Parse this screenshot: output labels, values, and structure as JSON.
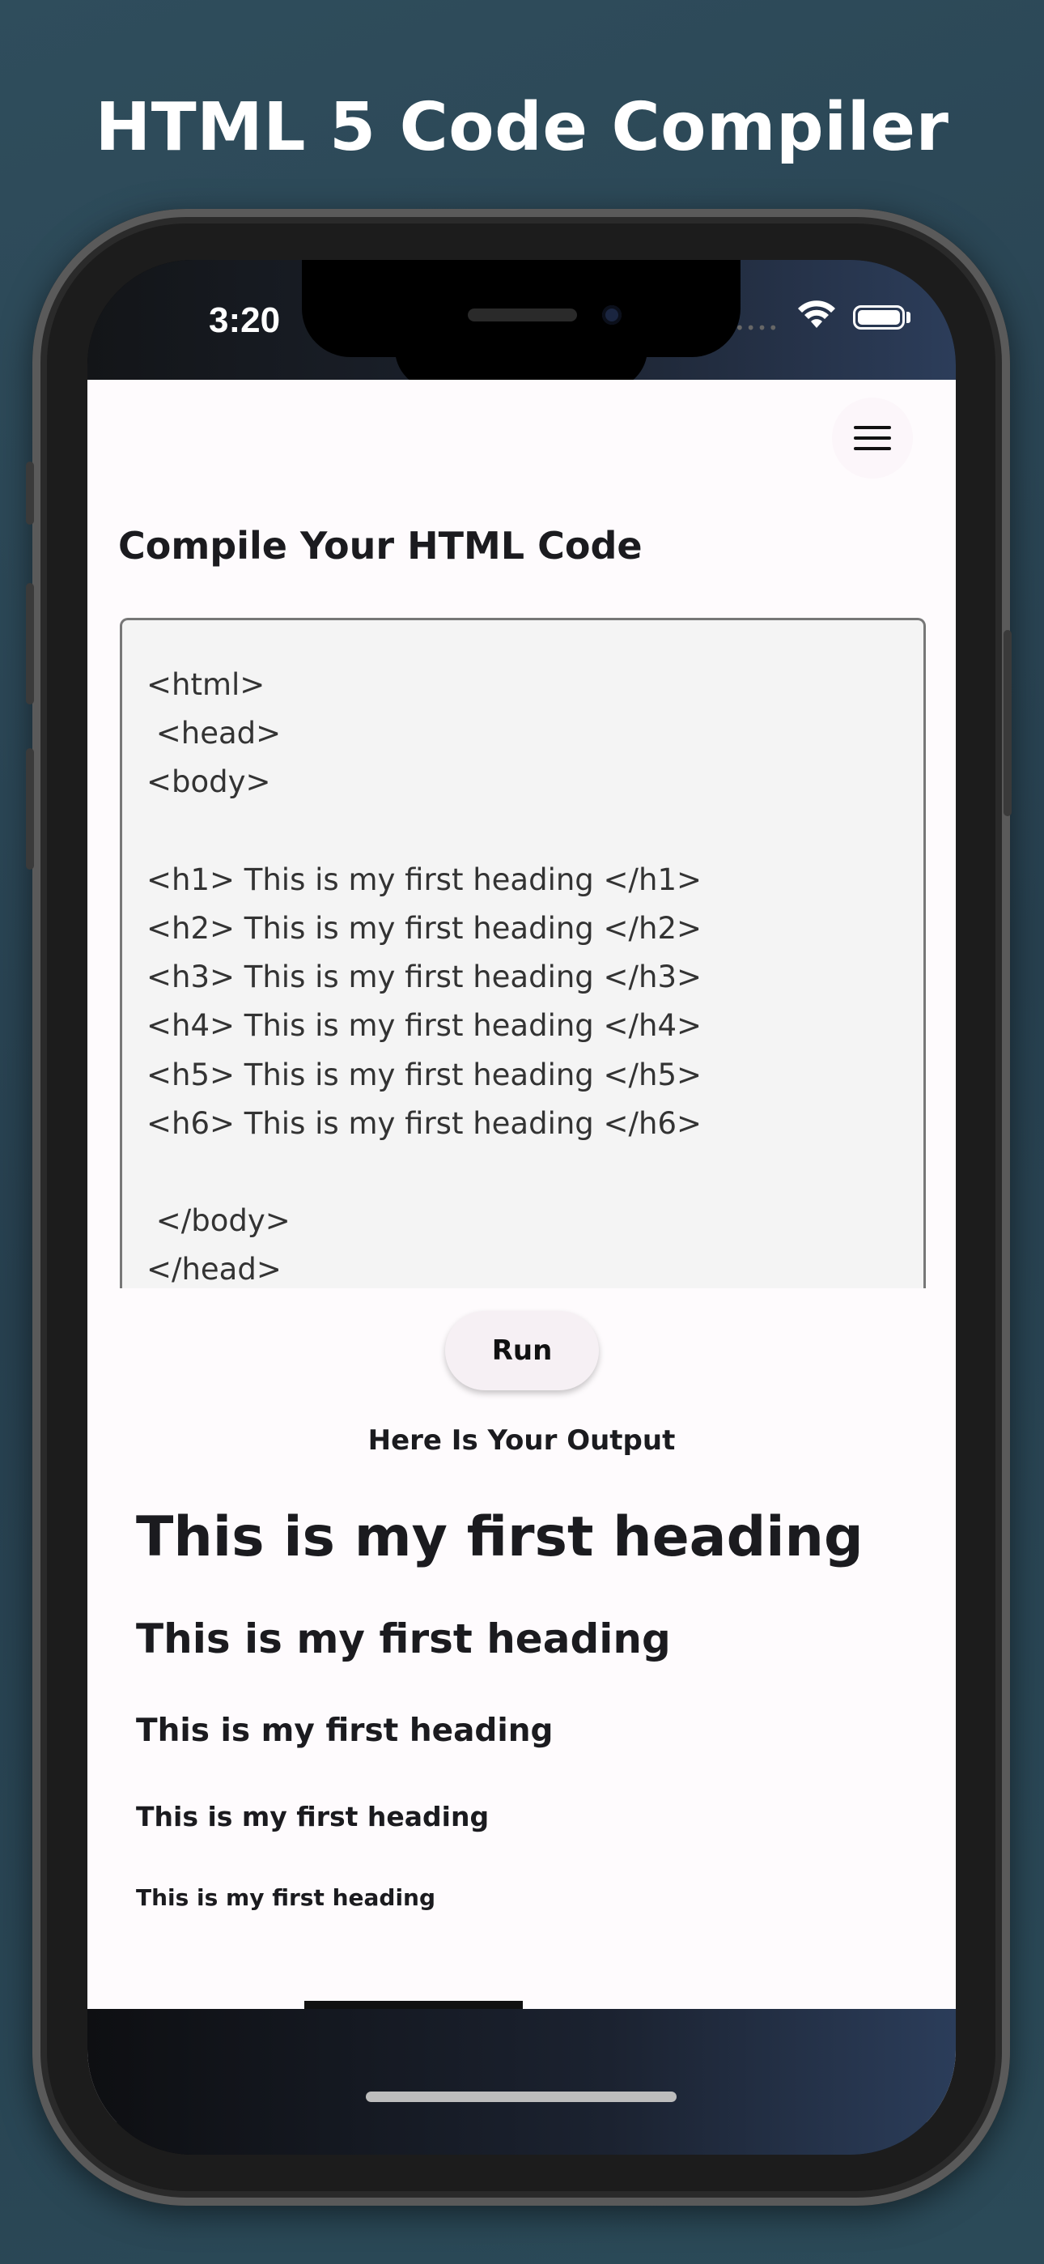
{
  "marketing": {
    "title": "HTML 5 Code Compiler"
  },
  "status_bar": {
    "time": "3:20",
    "signal": "••••"
  },
  "app": {
    "section_title": "Compile Your HTML Code",
    "code": "<html>\n <head>\n<body>\n\n<h1> This is my first heading </h1>\n<h2> This is my first heading </h2>\n<h3> This is my first heading </h3>\n<h4> This is my first heading </h4>\n<h5> This is my first heading </h5>\n<h6> This is my first heading </h6>\n\n </body>\n</head>",
    "run_label": "Run",
    "output_title": "Here Is Your Output",
    "output_headings": [
      "This is my first heading",
      "This is my first heading",
      "This is my first heading",
      "This is my first heading",
      "This is my first heading"
    ]
  },
  "tabs": [
    {
      "icon": "home-icon",
      "active": false
    },
    {
      "icon": "chat-icon",
      "active": true
    },
    {
      "icon": "web-layout-icon",
      "active": false
    },
    {
      "icon": "heart-icon",
      "active": false
    }
  ],
  "colors": {
    "background": "#2b4856",
    "app_background": "#fefbfd",
    "code_background": "#f4f4f4",
    "tab_active": "#1b1b1f",
    "tab_inactive": "#8a8a8a"
  }
}
